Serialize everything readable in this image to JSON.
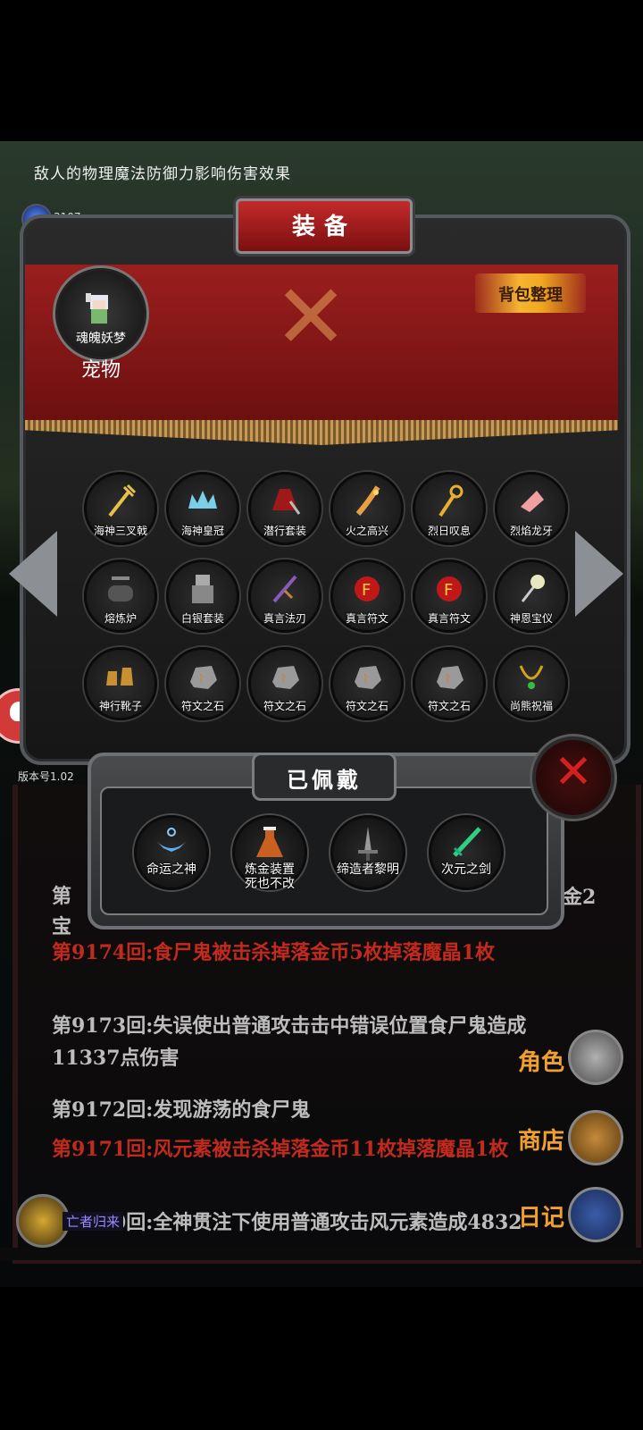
{
  "hint_text": "敌人的物理魔法防御力影响伤害效果",
  "currency_value": "3107",
  "version_label": "版本号1.02",
  "panel": {
    "title": "装备",
    "sort_button": "背包整理",
    "pet": {
      "name": "魂魄妖梦",
      "label": "宠物"
    }
  },
  "inventory": [
    {
      "label": "海神三叉戟",
      "icon": "trident-icon"
    },
    {
      "label": "海神皇冠",
      "icon": "crown-icon"
    },
    {
      "label": "潜行套装",
      "icon": "stealth-armor-icon"
    },
    {
      "label": "火之高兴",
      "icon": "fire-blade-icon"
    },
    {
      "label": "烈日叹息",
      "icon": "sun-staff-icon"
    },
    {
      "label": "烈焰龙牙",
      "icon": "dragon-fang-icon"
    },
    {
      "label": "熔炼炉",
      "icon": "furnace-icon"
    },
    {
      "label": "白银套装",
      "icon": "silver-armor-icon"
    },
    {
      "label": "真言法刃",
      "icon": "mantra-blade-icon"
    },
    {
      "label": "真言符文",
      "icon": "rune-red-icon"
    },
    {
      "label": "真言符文",
      "icon": "rune-red-icon"
    },
    {
      "label": "神恩宝仪",
      "icon": "holy-scepter-icon"
    },
    {
      "label": "神行靴子",
      "icon": "boots-icon"
    },
    {
      "label": "符文之石",
      "icon": "rune-stone-icon"
    },
    {
      "label": "符文之石",
      "icon": "rune-stone-icon"
    },
    {
      "label": "符文之石",
      "icon": "rune-stone-icon"
    },
    {
      "label": "符文之石",
      "icon": "rune-stone-icon"
    },
    {
      "label": "尚熊祝福",
      "icon": "necklace-icon"
    }
  ],
  "equipped": {
    "title": "已佩戴",
    "items": [
      {
        "label": "命运之神",
        "icon": "fate-amulet-icon"
      },
      {
        "label": "炼金装置\n死也不改",
        "icon": "alchemy-flask-icon"
      },
      {
        "label": "缔造者黎明",
        "icon": "greatsword-icon"
      },
      {
        "label": "次元之剑",
        "icon": "dimension-sword-icon"
      }
    ]
  },
  "log": {
    "cut_left": "第\n宝",
    "cut_right": "金2",
    "entries": [
      {
        "text": "第9174回:食尸鬼被击杀掉落金币5枚掉落魔晶1枚",
        "color": "red"
      },
      {
        "text": "第9173回:失误使出普通攻击击中错误位置食尸鬼造成11337点伤害",
        "color": "gray"
      },
      {
        "text": "第9172回:发现游荡的食尸鬼",
        "color": "gray"
      },
      {
        "text": "第9171回:风元素被击杀掉落金币11枚掉落魔晶1枚",
        "color": "red"
      },
      {
        "text": "第9170回:全神贯注下使用普通攻击风元素造成4832",
        "color": "gray"
      }
    ]
  },
  "side_menu": {
    "role": "角色",
    "shop": "商店",
    "diary": "日记"
  },
  "undead_label": "亡者归来",
  "colors": {
    "banner": "#9b1e1e",
    "accent_gold": "#f6b531",
    "log_red": "#c22a1e",
    "log_gray": "#bdbdbd"
  }
}
